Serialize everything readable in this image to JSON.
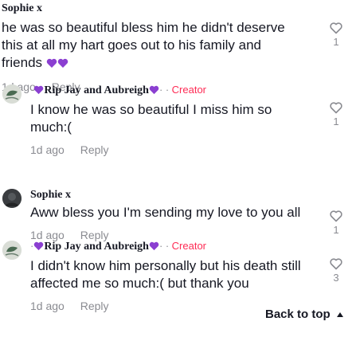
{
  "comments": [
    {
      "author": "Sophie x",
      "text": "he was so beautiful bless him he didn't deserve this at all my hart goes out to his family and friends",
      "time": "1d ago",
      "reply": "Reply",
      "likes": "1"
    },
    {
      "author": "Rip Jay and Aubreigh",
      "badge": "Creator",
      "text": "I know he was so beautiful I miss him so much:(",
      "time": "1d ago",
      "reply": "Reply",
      "likes": "1"
    },
    {
      "author": "Sophie x",
      "text": "Aww bless you I'm sending my love to you all",
      "time": "1d ago",
      "reply": "Reply",
      "likes": "1"
    },
    {
      "author": "Rip Jay and Aubreigh",
      "badge": "Creator",
      "text": "I didn't know him personally but his death still affected me so much:( but thank you",
      "time": "1d ago",
      "reply": "Reply",
      "likes": "3"
    }
  ],
  "back_to_top": "Back to top",
  "separator": "·",
  "icons": {
    "heart": "heart-outline-icon",
    "inline_heart": "purple-heart-icon",
    "arrow": "caret-up-icon"
  },
  "colors": {
    "creator": "#fe2c55",
    "muted": "#8a8b91",
    "heart_purple": "#8b3fd1"
  }
}
